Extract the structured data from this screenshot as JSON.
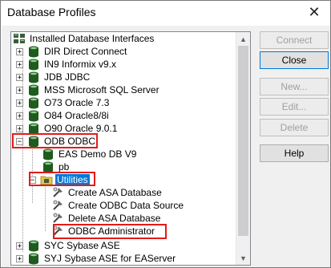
{
  "window": {
    "title": "Database Profiles",
    "close_glyph": "✕"
  },
  "tree": {
    "root_label": "Installed Database Interfaces",
    "interfaces": [
      {
        "label": "DIR Direct Connect",
        "expander": "+"
      },
      {
        "label": "IN9 Informix v9.x",
        "expander": "+"
      },
      {
        "label": "JDB JDBC",
        "expander": "+"
      },
      {
        "label": "MSS Microsoft SQL Server",
        "expander": "+"
      },
      {
        "label": "O73 Oracle 7.3",
        "expander": "+"
      },
      {
        "label": "O84 Oracle8/8i",
        "expander": "+"
      },
      {
        "label": "O90 Oracle 9.0.1",
        "expander": "+"
      }
    ],
    "odbc": {
      "label": "ODB ODBC",
      "expander": "−",
      "profiles": [
        "EAS Demo DB V9",
        "pb"
      ],
      "utilities": {
        "label": "Utilities",
        "expander": "−",
        "items": [
          "Create ASA Database",
          "Create ODBC Data Source",
          "Delete ASA Database",
          "ODBC Administrator"
        ]
      }
    },
    "bottom_interfaces": [
      {
        "label": "SYC Sybase ASE",
        "expander": "+"
      },
      {
        "label": "SYJ Sybase ASE for EAServer",
        "expander": "+"
      }
    ]
  },
  "buttons": {
    "connect": "Connect",
    "close": "Close",
    "new": "New...",
    "edit": "Edit...",
    "delete": "Delete",
    "help": "Help"
  },
  "colors": {
    "selection": "#0078d7",
    "highlight_box": "#e41a1a"
  },
  "icons": {
    "root": "database-tree-icon",
    "interface": "database-icon",
    "folder": "utilities-folder-icon",
    "utility": "utility-tool-icon"
  }
}
